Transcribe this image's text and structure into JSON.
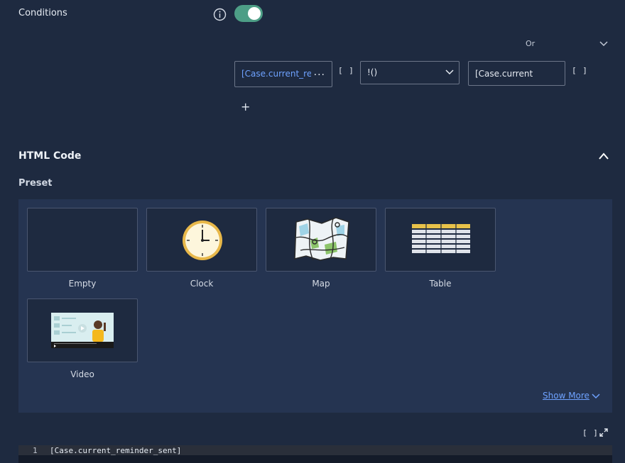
{
  "conditions": {
    "title": "Conditions",
    "toggle_on": true,
    "logic_operator": "Or",
    "row": {
      "left_value": "[Case.current_re",
      "left_more": "...",
      "left_bracket": "[ ]",
      "operator": "!()",
      "right_value": "[Case.current",
      "right_bracket": "[ ]"
    },
    "add_label": "+"
  },
  "html_code": {
    "title": "HTML Code",
    "preset_title": "Preset",
    "presets": [
      {
        "label": "Empty",
        "icon": "empty-preset-icon"
      },
      {
        "label": "Clock",
        "icon": "clock-icon"
      },
      {
        "label": "Map",
        "icon": "map-icon"
      },
      {
        "label": "Table",
        "icon": "table-icon"
      },
      {
        "label": "Video",
        "icon": "video-icon"
      }
    ],
    "show_more": "Show More",
    "editor_bracket": "[ ]",
    "editor": {
      "line_number": "1",
      "code": "[Case.current_reminder_sent]"
    }
  },
  "colors": {
    "background": "#1e2a40",
    "panel": "#253451",
    "toggle": "#4d9e86",
    "link": "#6ea2ff"
  }
}
